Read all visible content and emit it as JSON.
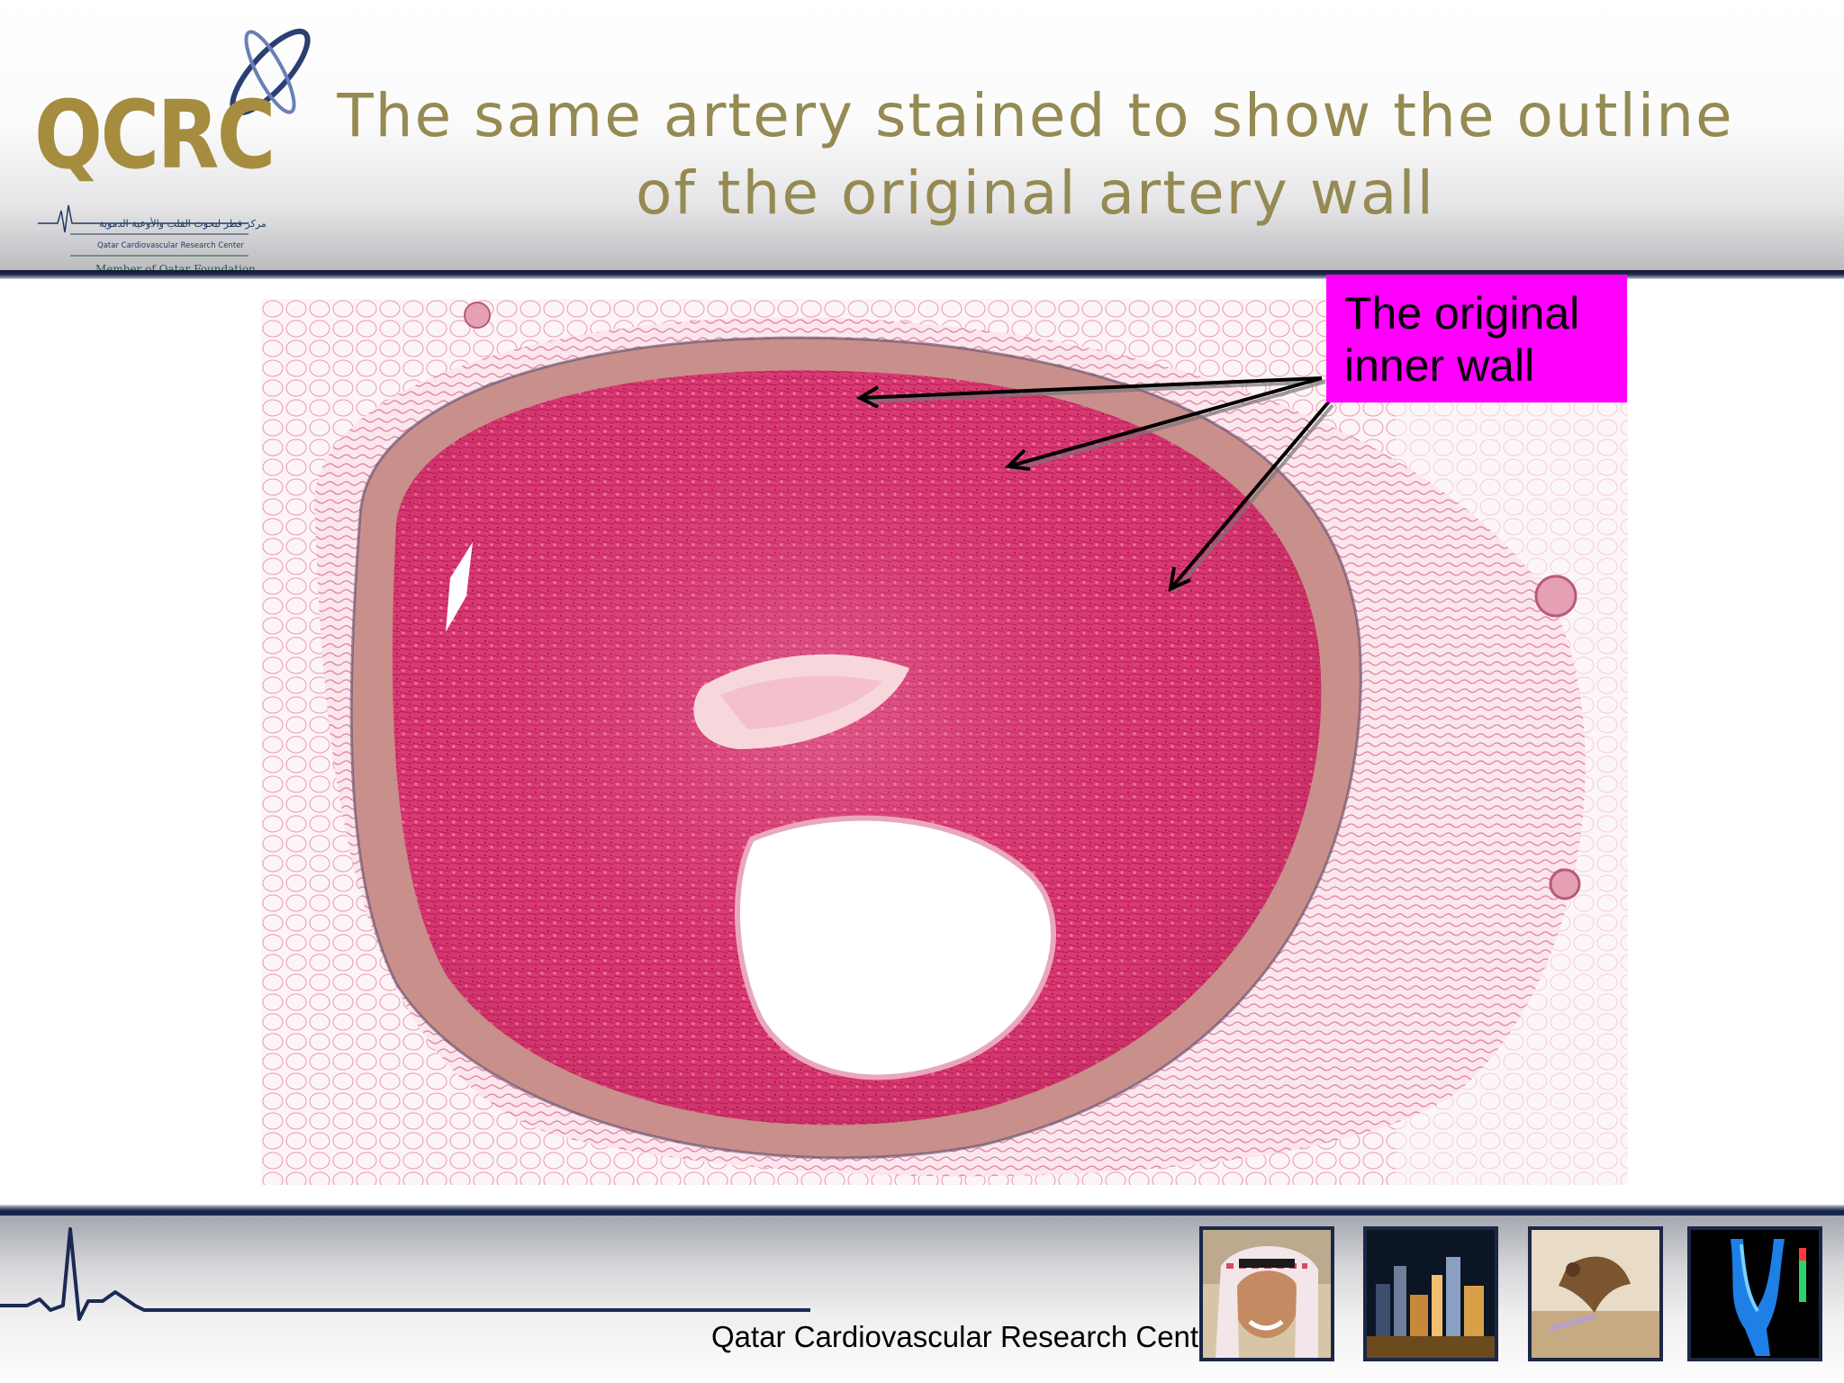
{
  "slide": {
    "title": "The same artery stained to show the outline of the original artery wall",
    "callout_label": "The original inner wall",
    "footer_text": "Qatar Cardiovascular Research Centre"
  },
  "logo": {
    "wordmark": "QCRC",
    "arabic_name": "مركز قطر لبحوث القلب والأوعية الدموية",
    "english_name": "Qatar Cardiovascular Research Center",
    "member_line": "Member of Qatar Foundation"
  },
  "thumbnails": [
    {
      "name": "smiling-man-photo"
    },
    {
      "name": "city-skyline-night-photo"
    },
    {
      "name": "falcon-photo"
    },
    {
      "name": "aorta-scan-image"
    }
  ],
  "colors": {
    "title": "#958a52",
    "logo_gold": "#a58c3e",
    "callout_bg": "#ff00ff",
    "navy_rule": "#12204a",
    "tissue_pink": "#d8306a"
  }
}
